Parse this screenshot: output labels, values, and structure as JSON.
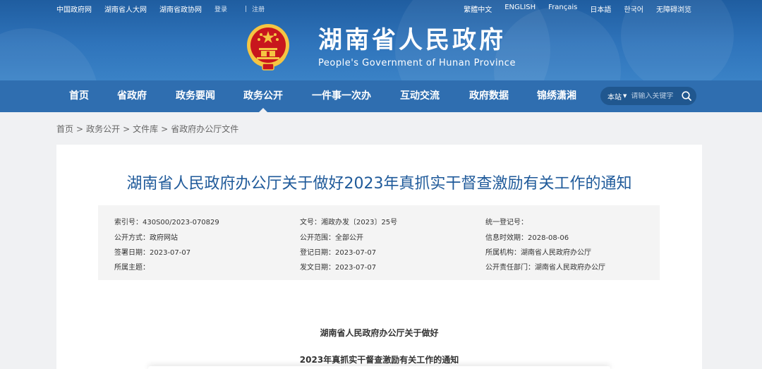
{
  "topbar": {
    "left_links": [
      "中国政府网",
      "湖南省人大网",
      "湖南省政协网"
    ],
    "login": "登录",
    "divider": "|",
    "register": "注册",
    "languages": [
      "繁體中文",
      "ENGLISH",
      "Français",
      "日本語",
      "한국어",
      "无障碍浏览"
    ]
  },
  "brand": {
    "title_cn": "湖南省人民政府",
    "title_en": "People's Government of Hunan Province"
  },
  "nav": {
    "items": [
      "首页",
      "省政府",
      "政务要闻",
      "政务公开",
      "一件事一次办",
      "互动交流",
      "政府数据",
      "锦绣潇湘"
    ],
    "active": "政务公开"
  },
  "search": {
    "scope": "本站",
    "placeholder": "请输入关键字"
  },
  "breadcrumb": [
    "首页",
    "政务公开",
    "文件库",
    "省政府办公厅文件"
  ],
  "document": {
    "title": "湖南省人民政府办公厅关于做好2023年真抓实干督查激励有关工作的通知",
    "meta": [
      [
        "索引号：430S00/2023-070829",
        "文号：湘政办发〔2023〕25号",
        "统一登记号："
      ],
      [
        "公开方式：政府网站",
        "公开范围：全部公开",
        "信息时效期：2028-08-06"
      ],
      [
        "签署日期：2023-07-07",
        "登记日期：2023-07-07",
        "所属机构：湖南省人民政府办公厅"
      ],
      [
        "所属主题：",
        "发文日期：2023-07-07",
        "公开责任部门：湖南省人民政府办公厅"
      ]
    ],
    "body_line_1": "湖南省人民政府办公厅关于做好",
    "body_line_2": "2023年真抓实干督查激励有关工作的通知"
  },
  "colors": {
    "header_blue": "#2f74bb",
    "nav_blue": "#2f6eb0",
    "title_blue": "#1f5a9a",
    "emblem_red": "#c8161d",
    "emblem_gold": "#f5c542"
  }
}
